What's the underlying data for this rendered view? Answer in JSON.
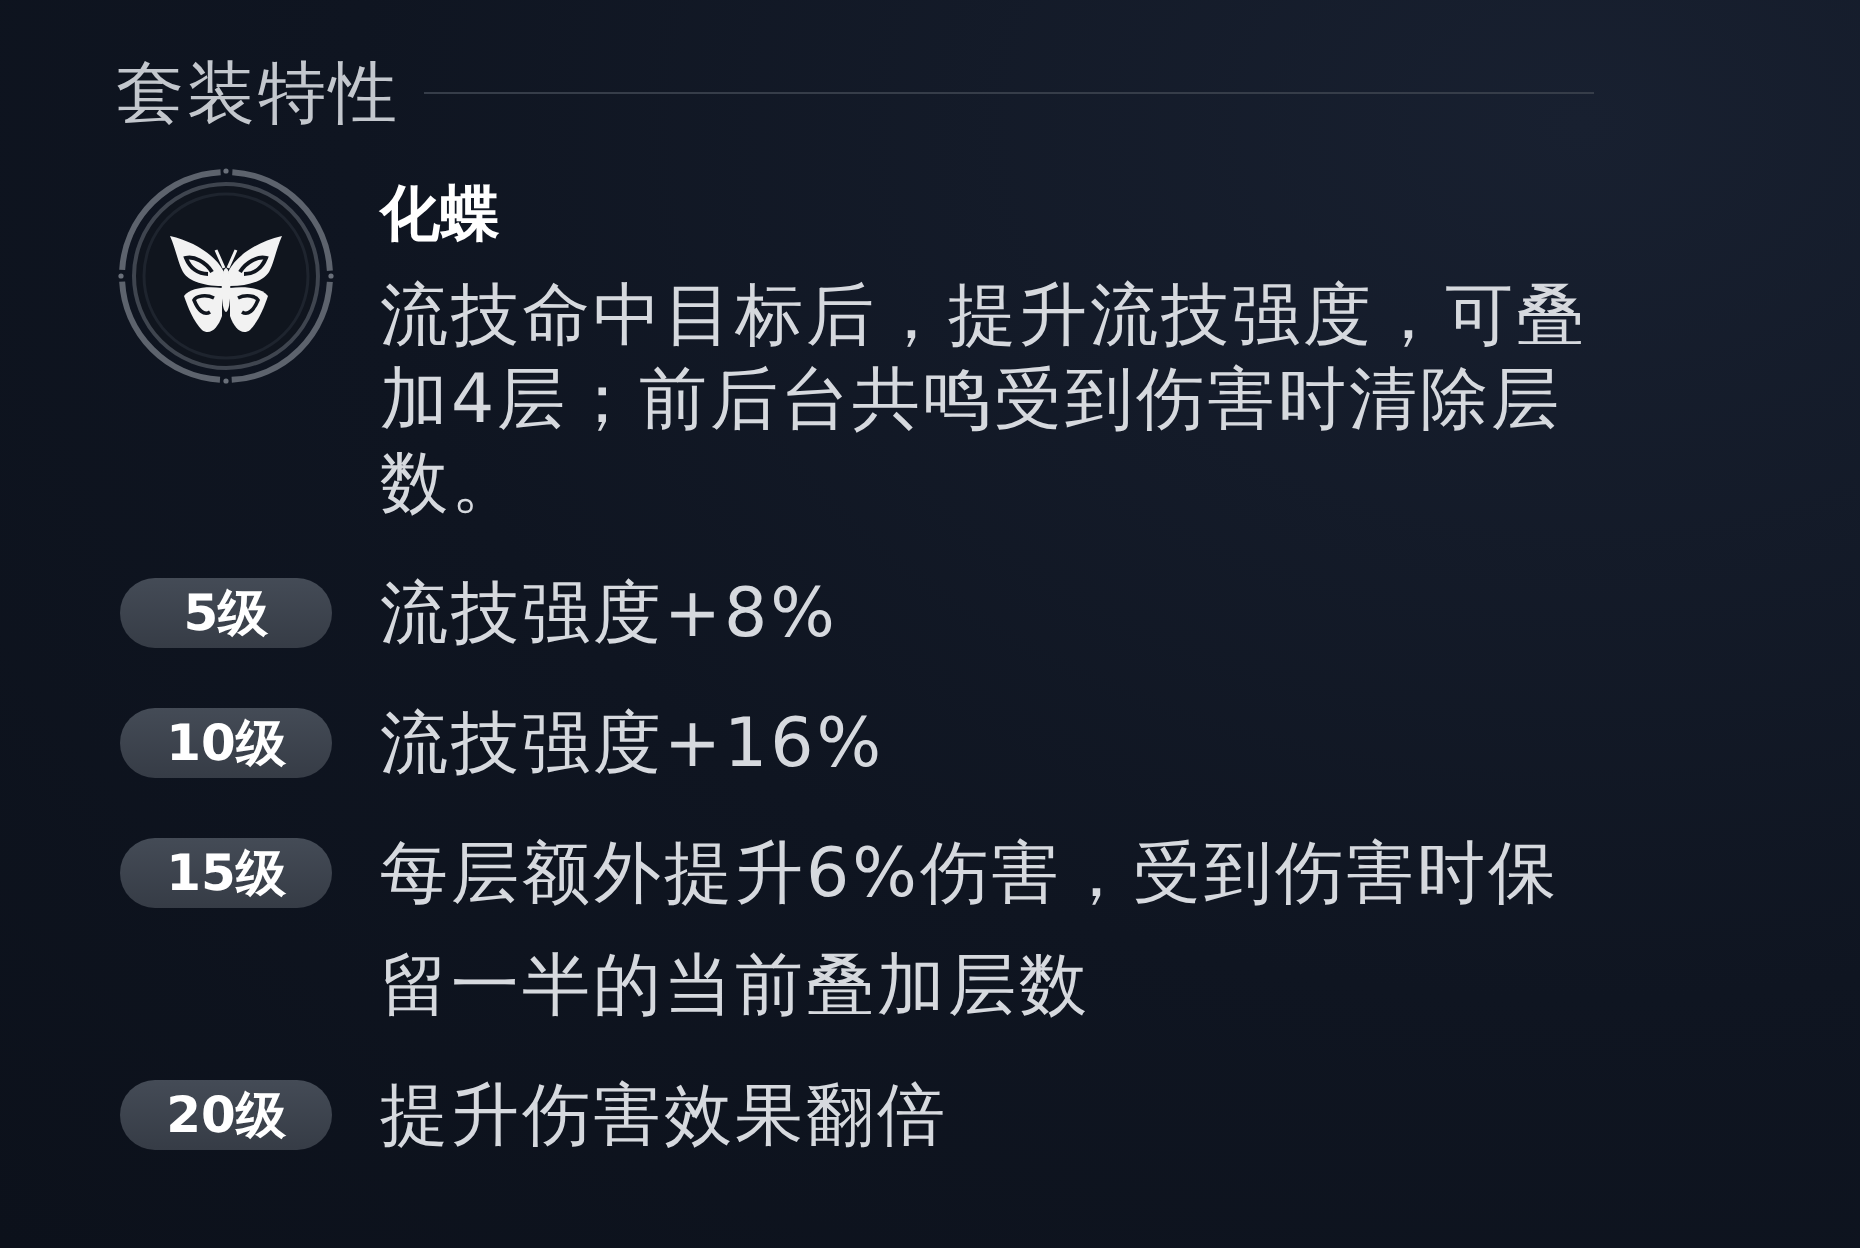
{
  "section": {
    "title": "套装特性"
  },
  "set_effect": {
    "name": "化蝶",
    "description": "流技命中目标后，提升流技强度，可叠加4层；前后台共鸣受到伤害时清除层数。"
  },
  "levels": [
    {
      "badge": "5级",
      "effect": "流技强度+8%"
    },
    {
      "badge": "10级",
      "effect": "流技强度+16%"
    },
    {
      "badge": "15级",
      "effect": "每层额外提升6%伤害，受到伤害时保留一半的当前叠加层数"
    },
    {
      "badge": "20级",
      "effect": "提升伤害效果翻倍"
    }
  ]
}
